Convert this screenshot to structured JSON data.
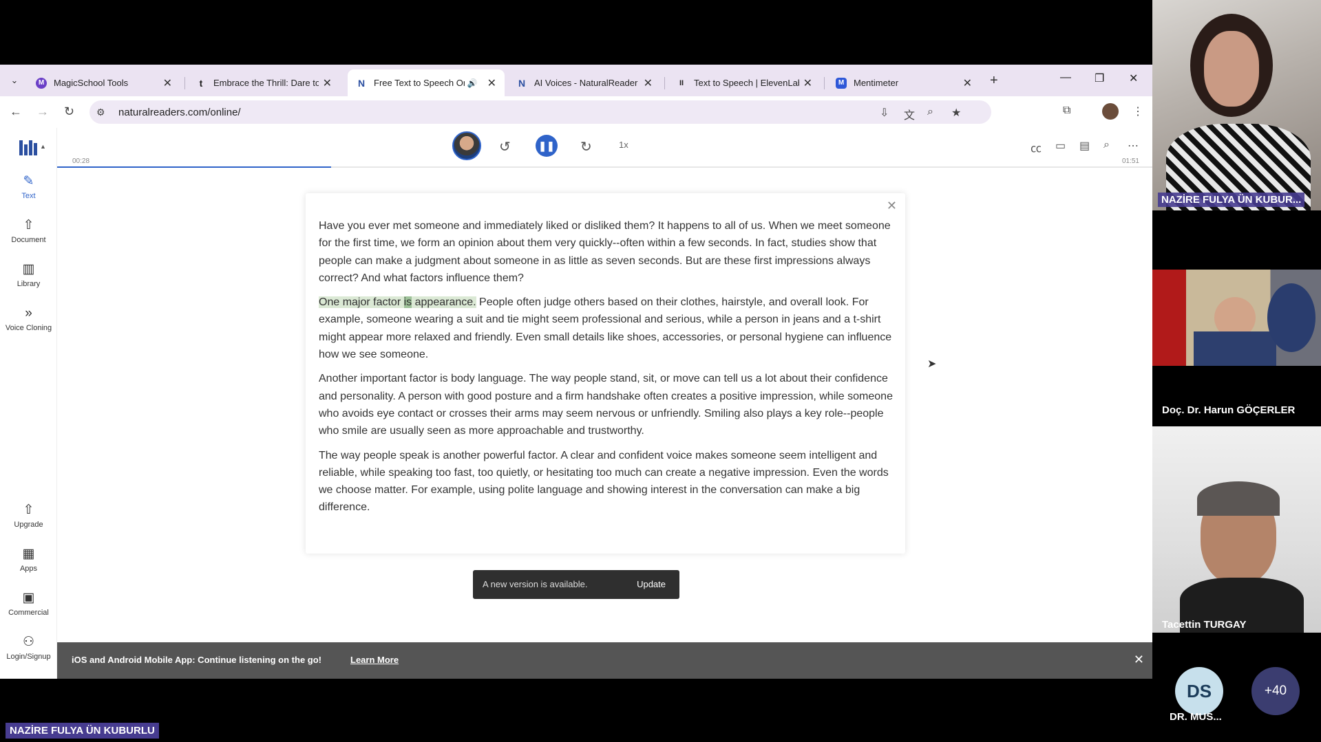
{
  "browser": {
    "tabs": [
      {
        "title": "MagicSchool Tools",
        "favicon": "magicschool-icon",
        "color": "#6b3fc7",
        "letter": "M"
      },
      {
        "title": "Embrace the Thrill: Dare to",
        "favicon": "tumblr-icon",
        "color": "#1f1f1f",
        "letter": "t"
      },
      {
        "title": "Free Text to Speech On",
        "favicon": "naturalreader-icon",
        "color": "#2b4fa0",
        "letter": "N",
        "active": true
      },
      {
        "title": "AI Voices - NaturalReader",
        "favicon": "naturalreader-icon",
        "color": "#2b4fa0",
        "letter": "N"
      },
      {
        "title": "Text to Speech | ElevenLab",
        "favicon": "elevenlabs-icon",
        "color": "#222222",
        "letter": "II"
      },
      {
        "title": "Mentimeter",
        "favicon": "mentimeter-icon",
        "color": "#2f58d8",
        "letter": "M"
      }
    ],
    "url": "naturalreaders.com/online/"
  },
  "sidebar": {
    "items": [
      {
        "label": "Text",
        "icon": "edit-icon"
      },
      {
        "label": "Document",
        "icon": "upload-icon"
      },
      {
        "label": "Library",
        "icon": "library-icon"
      },
      {
        "label": "Voice Cloning",
        "icon": "voice-cloning-icon"
      }
    ],
    "bottom_items": [
      {
        "label": "Upgrade",
        "icon": "upgrade-icon"
      },
      {
        "label": "Apps",
        "icon": "apps-icon"
      },
      {
        "label": "Commercial",
        "icon": "briefcase-icon"
      },
      {
        "label": "Login/Signup",
        "icon": "user-icon"
      }
    ]
  },
  "player": {
    "speed": "1x",
    "time_elapsed": "00:28",
    "time_total": "01:51",
    "progress": 0.25,
    "accent": "#2f63c9"
  },
  "document": {
    "p1": "Have you ever met someone and immediately liked or disliked them? It happens to all of us. When we meet someone for the first time, we form an opinion about them very quickly--often within a few seconds. In fact, studies show that people can make a judgment about someone in as little as seven seconds. But are these first impressions always correct? And what factors influence them?",
    "p2_hl_a": "One major factor ",
    "p2_hl_word": "is",
    "p2_hl_b": " appearance.",
    "p2_rest": " People often judge others based on their clothes, hairstyle, and overall look. For example, someone wearing a suit and tie might seem professional and serious, while a person in jeans and a t-shirt might appear more relaxed and friendly. Even small details like shoes, accessories, or personal hygiene can influence how we see someone.",
    "p3": "Another important factor is body language. The way people stand, sit, or move can tell us a lot about their confidence and personality. A person with good posture and a firm handshake often creates a positive impression, while someone who avoids eye contact or crosses their arms may seem nervous or unfriendly. Smiling also plays a key role--people who smile are usually seen as more approachable and trustworthy.",
    "p4": "The way people speak is another powerful factor. A clear and confident voice makes someone seem intelligent and reliable, while speaking too fast, too quietly, or hesitating too much can create a negative impression. Even the words we choose matter. For example, using polite language and showing interest in the conversation can make a big difference."
  },
  "banner": {
    "message": "iOS and Android Mobile App: Continue listening on the go!",
    "link": "Learn More"
  },
  "toast": {
    "message": "A new version is available.",
    "button": "Update"
  },
  "call": {
    "participants": [
      {
        "name": "NAZİRE FULYA ÜN KUBUR..."
      },
      {
        "name": "Doç. Dr. Harun GÖÇERLER"
      },
      {
        "name": "Tacettin TURGAY"
      }
    ],
    "avatar_initials": "DS",
    "avatar_name": "DR. MUS...",
    "more_count": "+40",
    "presenter": "NAZİRE FULYA ÜN KUBURLU"
  }
}
